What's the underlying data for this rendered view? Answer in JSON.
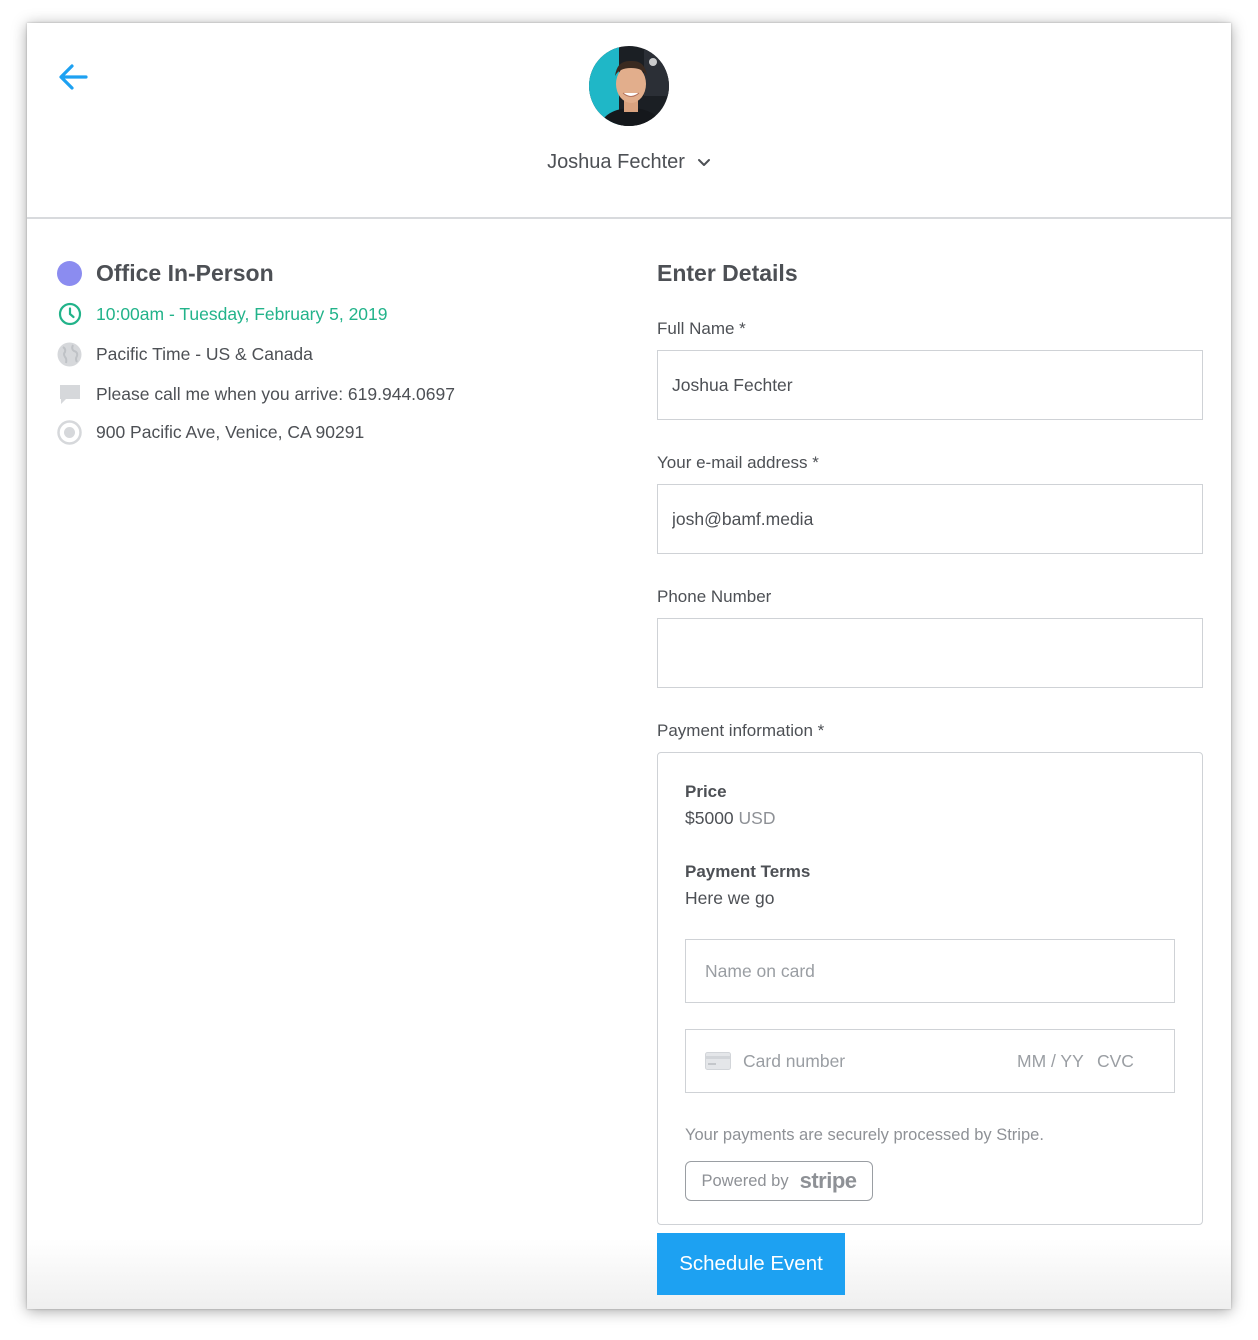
{
  "header": {
    "user_name": "Joshua Fechter",
    "accent": "#1da1f2"
  },
  "event": {
    "title": "Office In-Person",
    "color": "#8b8cf0",
    "datetime": "10:00am - Tuesday, February 5, 2019",
    "datetime_color": "#22b38a",
    "timezone": "Pacific Time - US & Canada",
    "note": "Please call me when you arrive: 619.944.0697",
    "location": "900 Pacific Ave, Venice, CA 90291"
  },
  "form": {
    "title": "Enter Details",
    "full_name_label": "Full Name *",
    "full_name_value": "Joshua Fechter",
    "email_label": "Your e-mail address *",
    "email_value": "josh@bamf.media",
    "phone_label": "Phone Number",
    "phone_value": "",
    "payment_label": "Payment information *"
  },
  "payment": {
    "price_label": "Price",
    "price_amount": "$5000",
    "price_currency": "USD",
    "terms_label": "Payment Terms",
    "terms_value": "Here we go",
    "name_on_card_placeholder": "Name on card",
    "card_number_placeholder": "Card number",
    "expiry_placeholder": "MM / YY",
    "cvc_placeholder": "CVC",
    "secure_note": "Your payments are securely processed by Stripe.",
    "powered_by": "Powered by",
    "stripe_word": "stripe"
  },
  "actions": {
    "schedule_label": "Schedule Event"
  }
}
